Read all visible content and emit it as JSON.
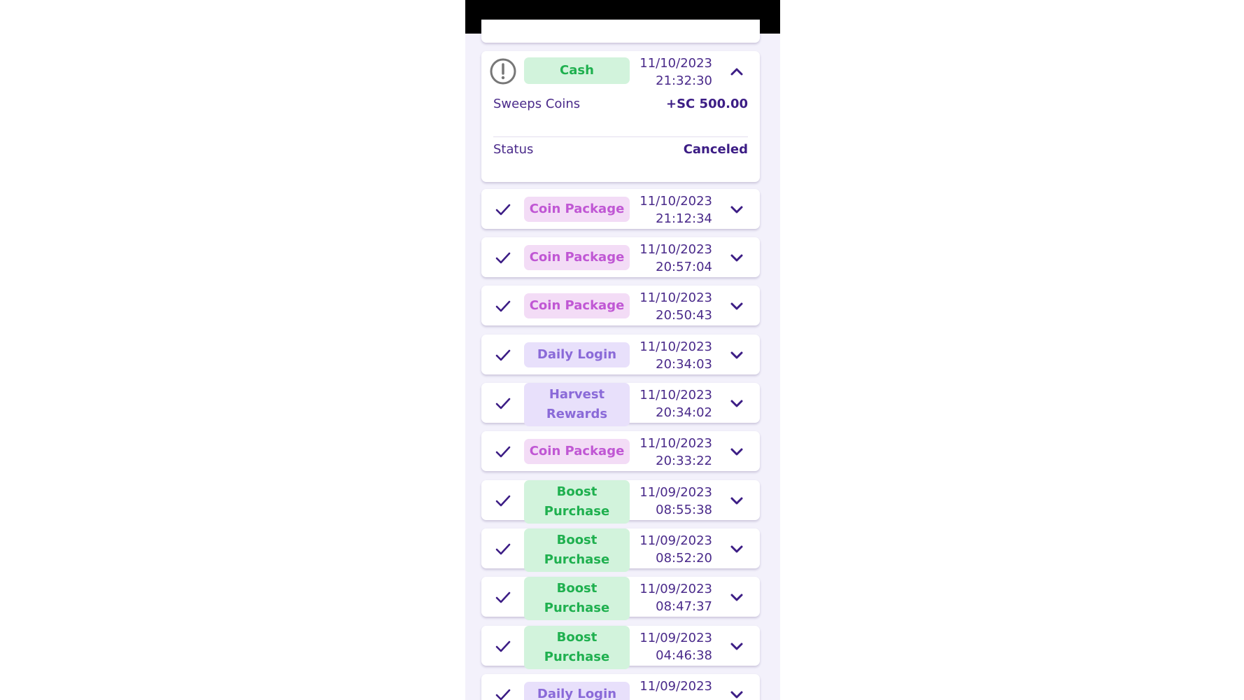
{
  "transaction_history": {
    "expanded": {
      "type": "Cash",
      "date": "11/10/2023",
      "time": "21:32:30",
      "details": {
        "coins_label": "Sweeps Coins",
        "coins_value": "+SC 500.00",
        "status_label": "Status",
        "status_value": "Canceled"
      }
    },
    "rows": [
      {
        "type": "Coin Package",
        "date": "11/10/2023",
        "time": "21:12:34"
      },
      {
        "type": "Coin Package",
        "date": "11/10/2023",
        "time": "20:57:04"
      },
      {
        "type": "Coin Package",
        "date": "11/10/2023",
        "time": "20:50:43"
      },
      {
        "type": "Daily Login",
        "date": "11/10/2023",
        "time": "20:34:03"
      },
      {
        "type": "Harvest Rewards",
        "date": "11/10/2023",
        "time": "20:34:02"
      },
      {
        "type": "Coin Package",
        "date": "11/10/2023",
        "time": "20:33:22"
      },
      {
        "type": "Boost Purchase",
        "date": "11/09/2023",
        "time": "08:55:38"
      },
      {
        "type": "Boost Purchase",
        "date": "11/09/2023",
        "time": "08:52:20"
      },
      {
        "type": "Boost Purchase",
        "date": "11/09/2023",
        "time": "08:47:37"
      },
      {
        "type": "Boost Purchase",
        "date": "11/09/2023",
        "time": "04:46:38"
      },
      {
        "type": "Daily Login",
        "date": "11/09/2023",
        "time": ""
      }
    ]
  },
  "colors": {
    "accent": "#4a2a8a",
    "cash_green": "#1fb04f",
    "coin_pink": "#c057d4",
    "daily_purple": "#8a6ad8"
  },
  "icons": {
    "expanded_status": "alert-circle-icon",
    "row_status": "check-icon",
    "expanded_toggle": "chevron-up-icon",
    "row_toggle": "chevron-down-icon"
  }
}
